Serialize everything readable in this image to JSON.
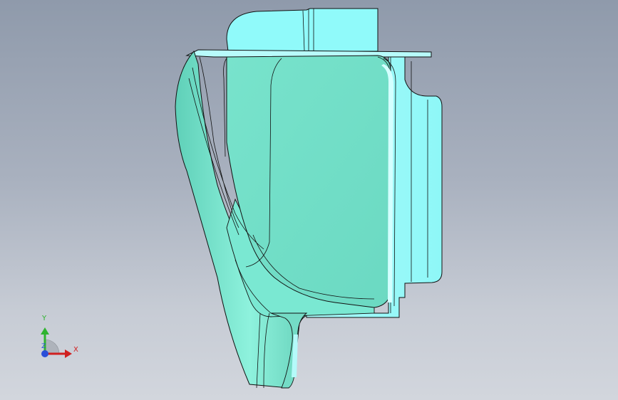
{
  "viewport": {
    "background_top": "#8f9aab",
    "background_bottom": "#d2d6dd"
  },
  "model": {
    "face_color": "#6fdcc5",
    "highlight_color": "#8ef7f7",
    "edge_color": "#101010"
  },
  "triad": {
    "x_label": "X",
    "y_label": "Y",
    "z_label": "Z",
    "x_color": "#d02020",
    "y_color": "#2fb32f",
    "z_color": "#2b4fd8"
  }
}
